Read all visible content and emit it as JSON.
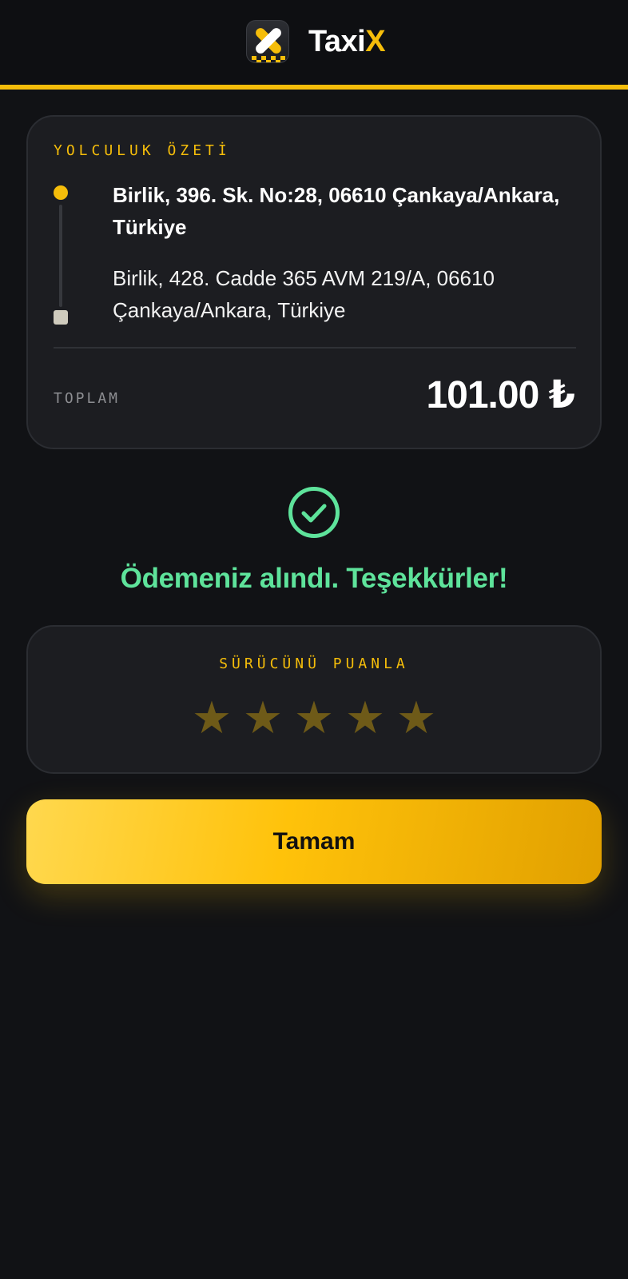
{
  "header": {
    "brand_name_main": "Taxi",
    "brand_name_accent": "X",
    "logo_icon": "taxi-x-logo-icon"
  },
  "summary": {
    "label": "YOLCULUK ÖZETİ",
    "from_address": "Birlik, 396. Sk. No:28, 06610 Çankaya/Ankara, Türkiye",
    "to_address": "Birlik, 428. Cadde 365 AVM 219/A, 06610 Çankaya/Ankara, Türkiye",
    "total_label": "TOPLAM",
    "total_value": "101.00 ₺"
  },
  "status": {
    "icon": "check-circle-icon",
    "message": "Ödemeniz alındı. Teşekkürler!"
  },
  "rating": {
    "label": "SÜRÜCÜNÜ PUANLA",
    "max": 5,
    "value": 0
  },
  "actions": {
    "ok_label": "Tamam"
  },
  "colors": {
    "accent": "#f5bd0a",
    "success": "#5ee39b",
    "background": "#111215",
    "card": "#1c1d21"
  }
}
